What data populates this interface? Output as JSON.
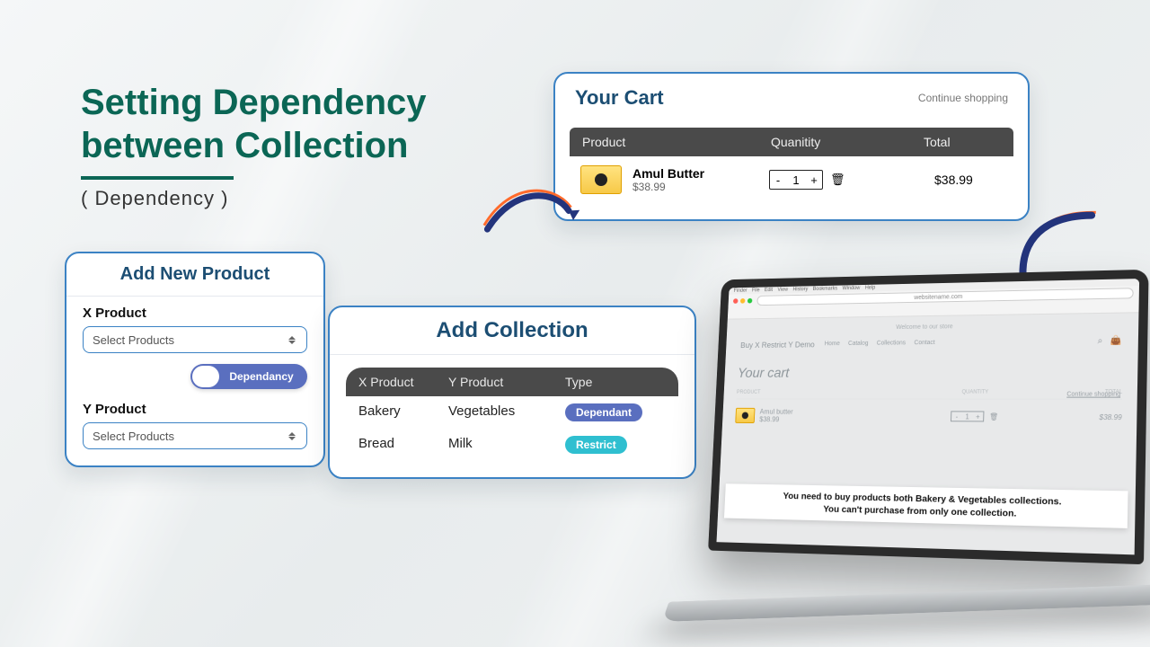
{
  "title": {
    "line1": "Setting Dependency",
    "line2": "between Collection",
    "subtitle": "( Dependency )"
  },
  "add_product": {
    "heading": "Add New Product",
    "x_label": "X Product",
    "x_placeholder": "Select Products",
    "toggle_label": "Dependancy",
    "y_label": "Y Product",
    "y_placeholder": "Select Products"
  },
  "add_collection": {
    "heading": "Add Collection",
    "columns": {
      "x": "X Product",
      "y": "Y Product",
      "type": "Type"
    },
    "rows": [
      {
        "x": "Bakery",
        "y": "Vegetables",
        "type": "Dependant",
        "kind": "dep"
      },
      {
        "x": "Bread",
        "y": "Milk",
        "type": "Restrict",
        "kind": "res"
      }
    ]
  },
  "cart": {
    "heading": "Your Cart",
    "continue": "Continue shopping",
    "columns": {
      "product": "Product",
      "qty": "Quanitity",
      "total": "Total"
    },
    "item": {
      "name": "Amul Butter",
      "price": "$38.99",
      "qty_minus": "-",
      "qty_plus": "+",
      "qty": "1",
      "total": "$38.99"
    }
  },
  "laptop": {
    "menu": [
      "Finder",
      "File",
      "Edit",
      "View",
      "History",
      "Bookmarks",
      "Window",
      "Help"
    ],
    "url": "websitename.com",
    "banner": "Welcome to our store",
    "brand": "Buy X Restrict Y Demo",
    "links": [
      "Home",
      "Catalog",
      "Collections",
      "Contact"
    ],
    "page_title": "Your cart",
    "continue": "Continue shopping",
    "thead": {
      "a": "PRODUCT",
      "b": "QUANTITY",
      "c": "TOTAL"
    },
    "row": {
      "name": "Amul butter",
      "price": "$38.99",
      "qty": "1",
      "total": "$38.99"
    },
    "warning_l1": "You need to buy products both Bakery & Vegetables collections.",
    "warning_l2": "You can't purchase from only one collection."
  }
}
